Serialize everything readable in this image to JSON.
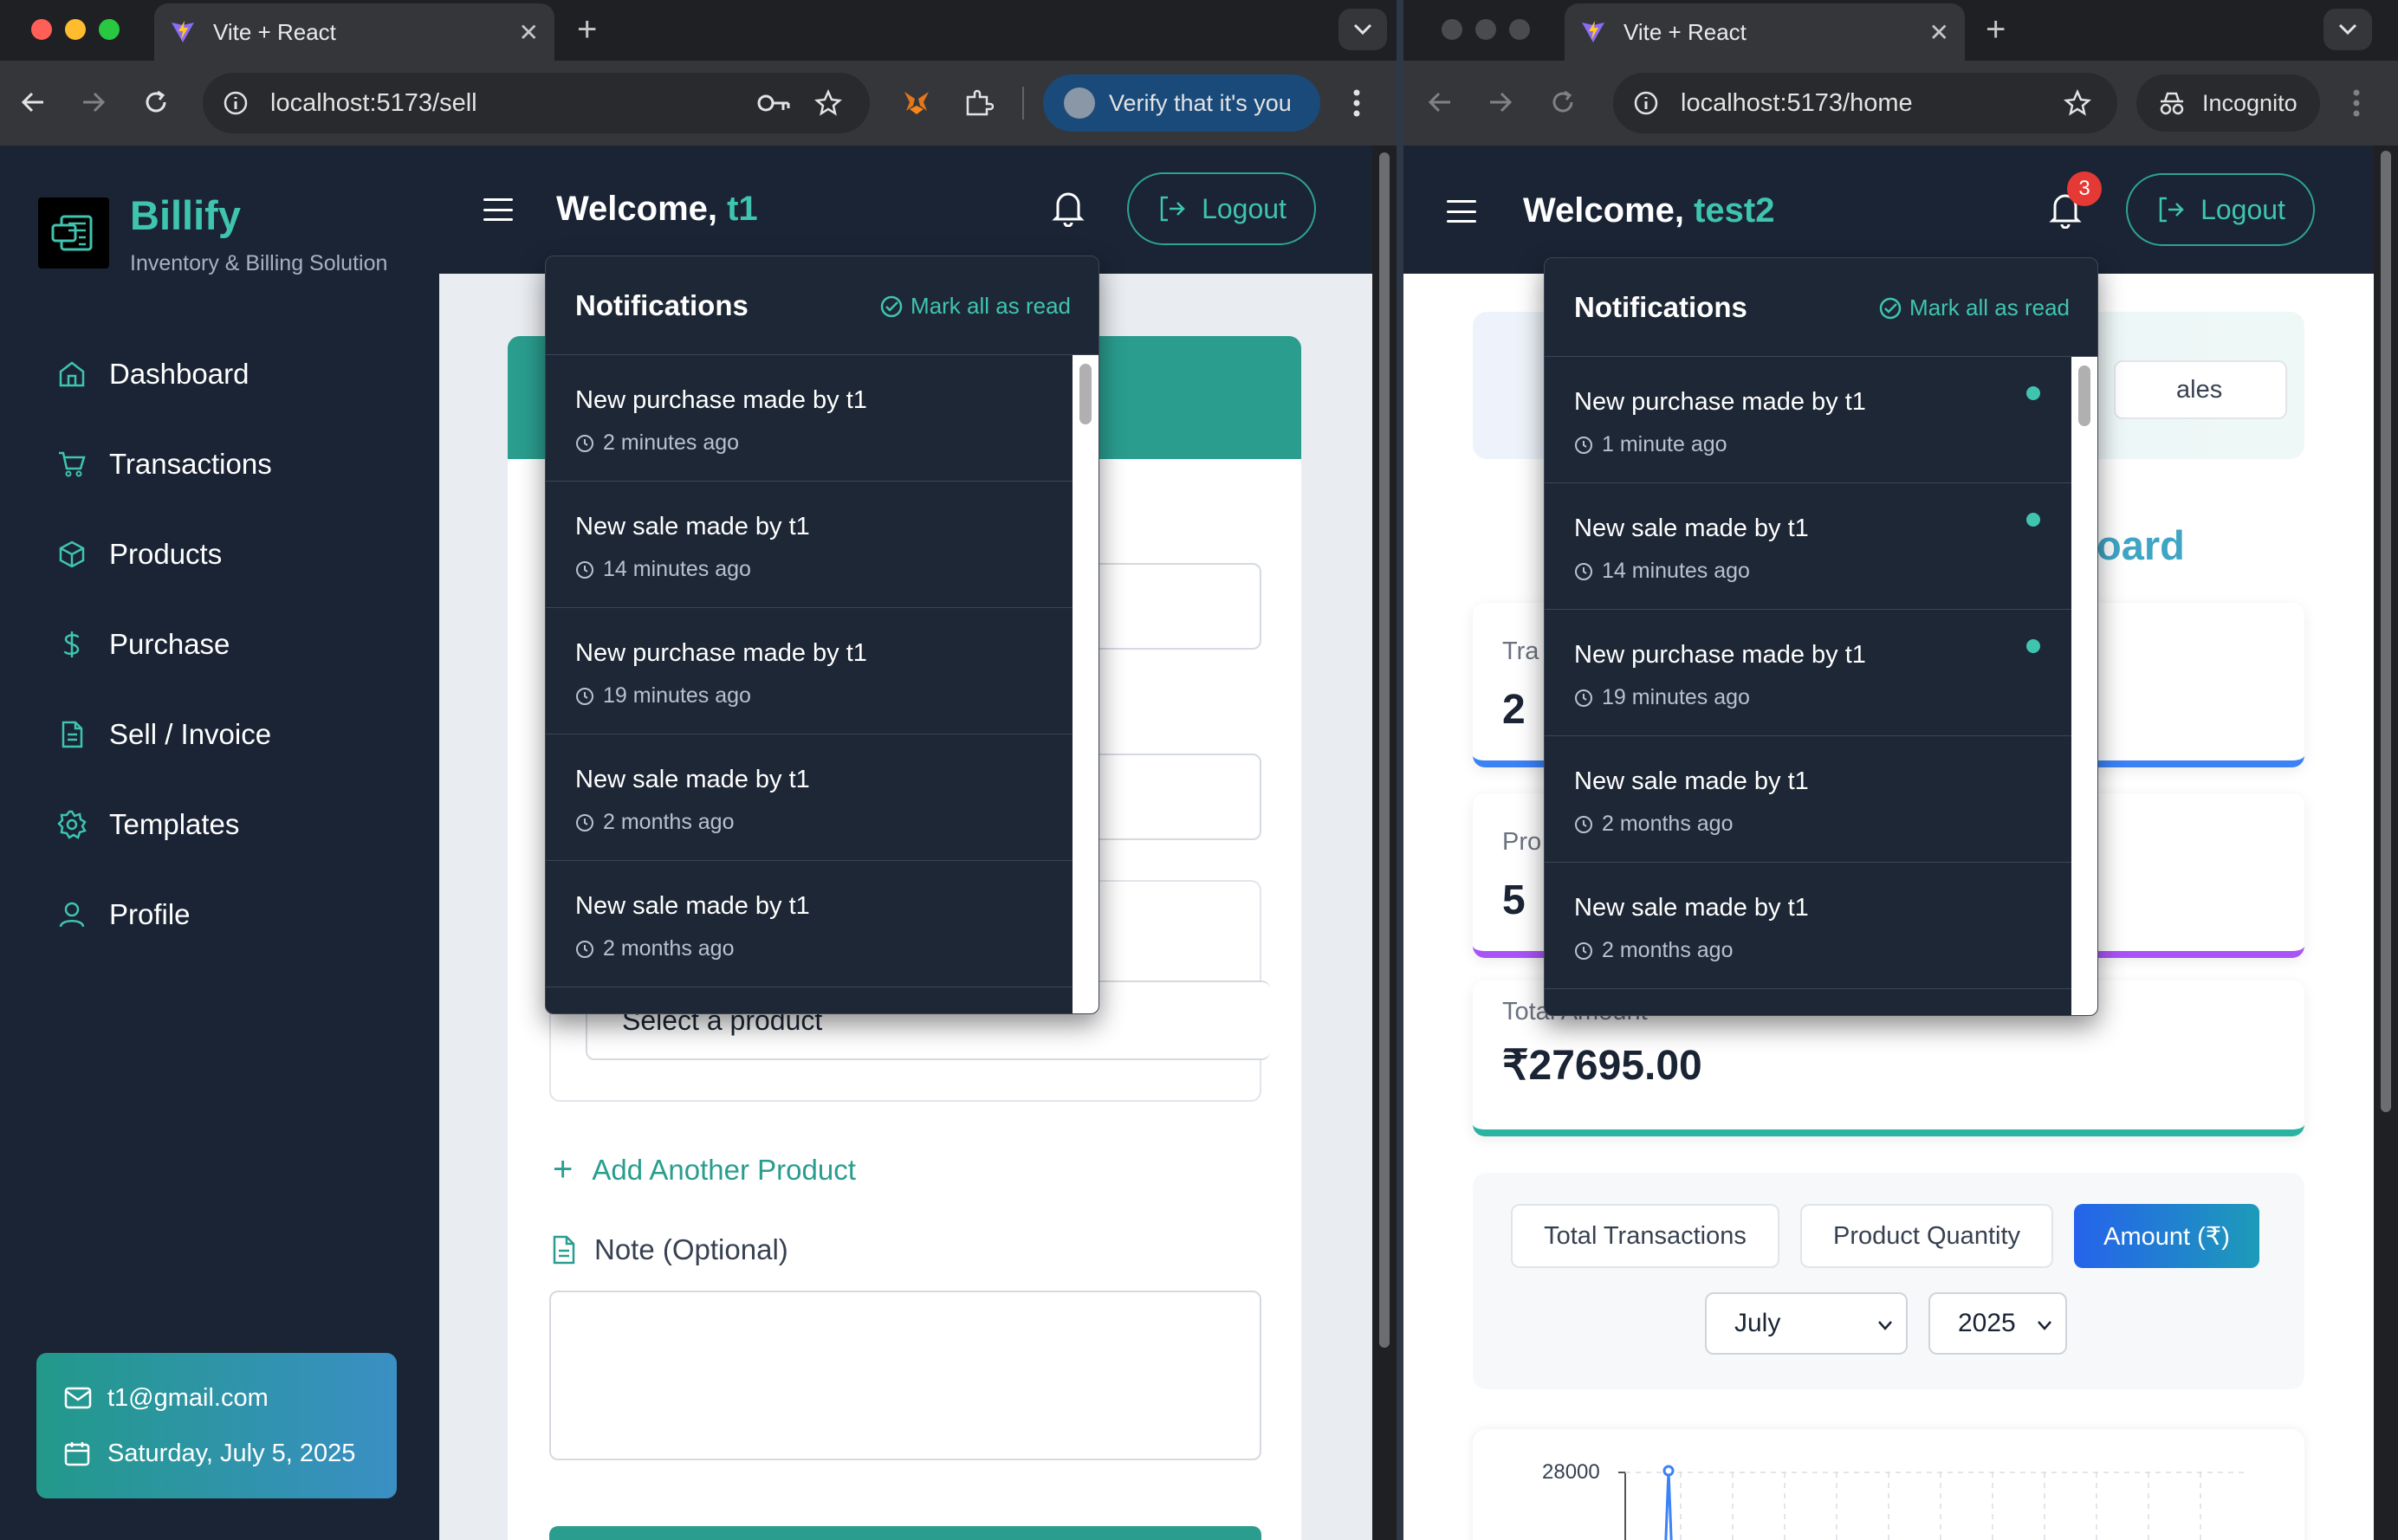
{
  "colors": {
    "accent": "#3fc4b0",
    "sidebar_bg": "#1a2434",
    "blue_button": "#2563eb",
    "badge": "#e53935"
  },
  "left_window": {
    "tab_title": "Vite + React",
    "url": "localhost:5173/sell",
    "profile_pill": "Verify that it's you",
    "app": {
      "brand": "Billify",
      "tagline": "Inventory & Billing Solution",
      "nav": [
        {
          "label": "Dashboard",
          "icon": "home-icon"
        },
        {
          "label": "Transactions",
          "icon": "cart-icon"
        },
        {
          "label": "Products",
          "icon": "box-icon"
        },
        {
          "label": "Purchase",
          "icon": "dollar-icon"
        },
        {
          "label": "Sell / Invoice",
          "icon": "file-icon"
        },
        {
          "label": "Templates",
          "icon": "gear-icon"
        },
        {
          "label": "Profile",
          "icon": "user-icon"
        }
      ],
      "user_email": "t1@gmail.com",
      "date": "Saturday, July 5, 2025",
      "welcome_prefix": "Welcome, ",
      "welcome_name": "t1",
      "logout": "Logout",
      "select_product_placeholder": "Select a product",
      "add_product": "Add Another Product",
      "note_label": "Note (Optional)"
    },
    "notifications": {
      "title": "Notifications",
      "mark_all": "Mark all as read",
      "items": [
        {
          "message": "New purchase made by t1",
          "time": "2 minutes ago"
        },
        {
          "message": "New sale made by t1",
          "time": "14 minutes ago"
        },
        {
          "message": "New purchase made by t1",
          "time": "19 minutes ago"
        },
        {
          "message": "New sale made by t1",
          "time": "2 months ago"
        },
        {
          "message": "New sale made by t1",
          "time": "2 months ago"
        }
      ]
    }
  },
  "right_window": {
    "tab_title": "Vite + React",
    "url": "localhost:5173/home",
    "incognito": "Incognito",
    "app": {
      "welcome_prefix": "Welcome, ",
      "welcome_name": "test2",
      "logout": "Logout",
      "badge_count": "3",
      "partial_button": "ales",
      "partial_heading": "oard",
      "stat1_label": "Tra",
      "stat1_value": "2",
      "stat2_label": "Pro",
      "stat2_value": "5",
      "stat3_label": "Total Amount",
      "stat3_value": "₹27695.00",
      "chart_tabs": [
        "Total Transactions",
        "Product Quantity",
        "Amount (₹)"
      ],
      "month": "July",
      "year": "2025",
      "chart_ytick": "28000"
    },
    "notifications": {
      "title": "Notifications",
      "mark_all": "Mark all as read",
      "items": [
        {
          "message": "New purchase made by t1",
          "time": "1 minute ago",
          "unread": true
        },
        {
          "message": "New sale made by t1",
          "time": "14 minutes ago",
          "unread": true
        },
        {
          "message": "New purchase made by t1",
          "time": "19 minutes ago",
          "unread": true
        },
        {
          "message": "New sale made by t1",
          "time": "2 months ago",
          "unread": false
        },
        {
          "message": "New sale made by t1",
          "time": "2 months ago",
          "unread": false
        }
      ]
    }
  }
}
